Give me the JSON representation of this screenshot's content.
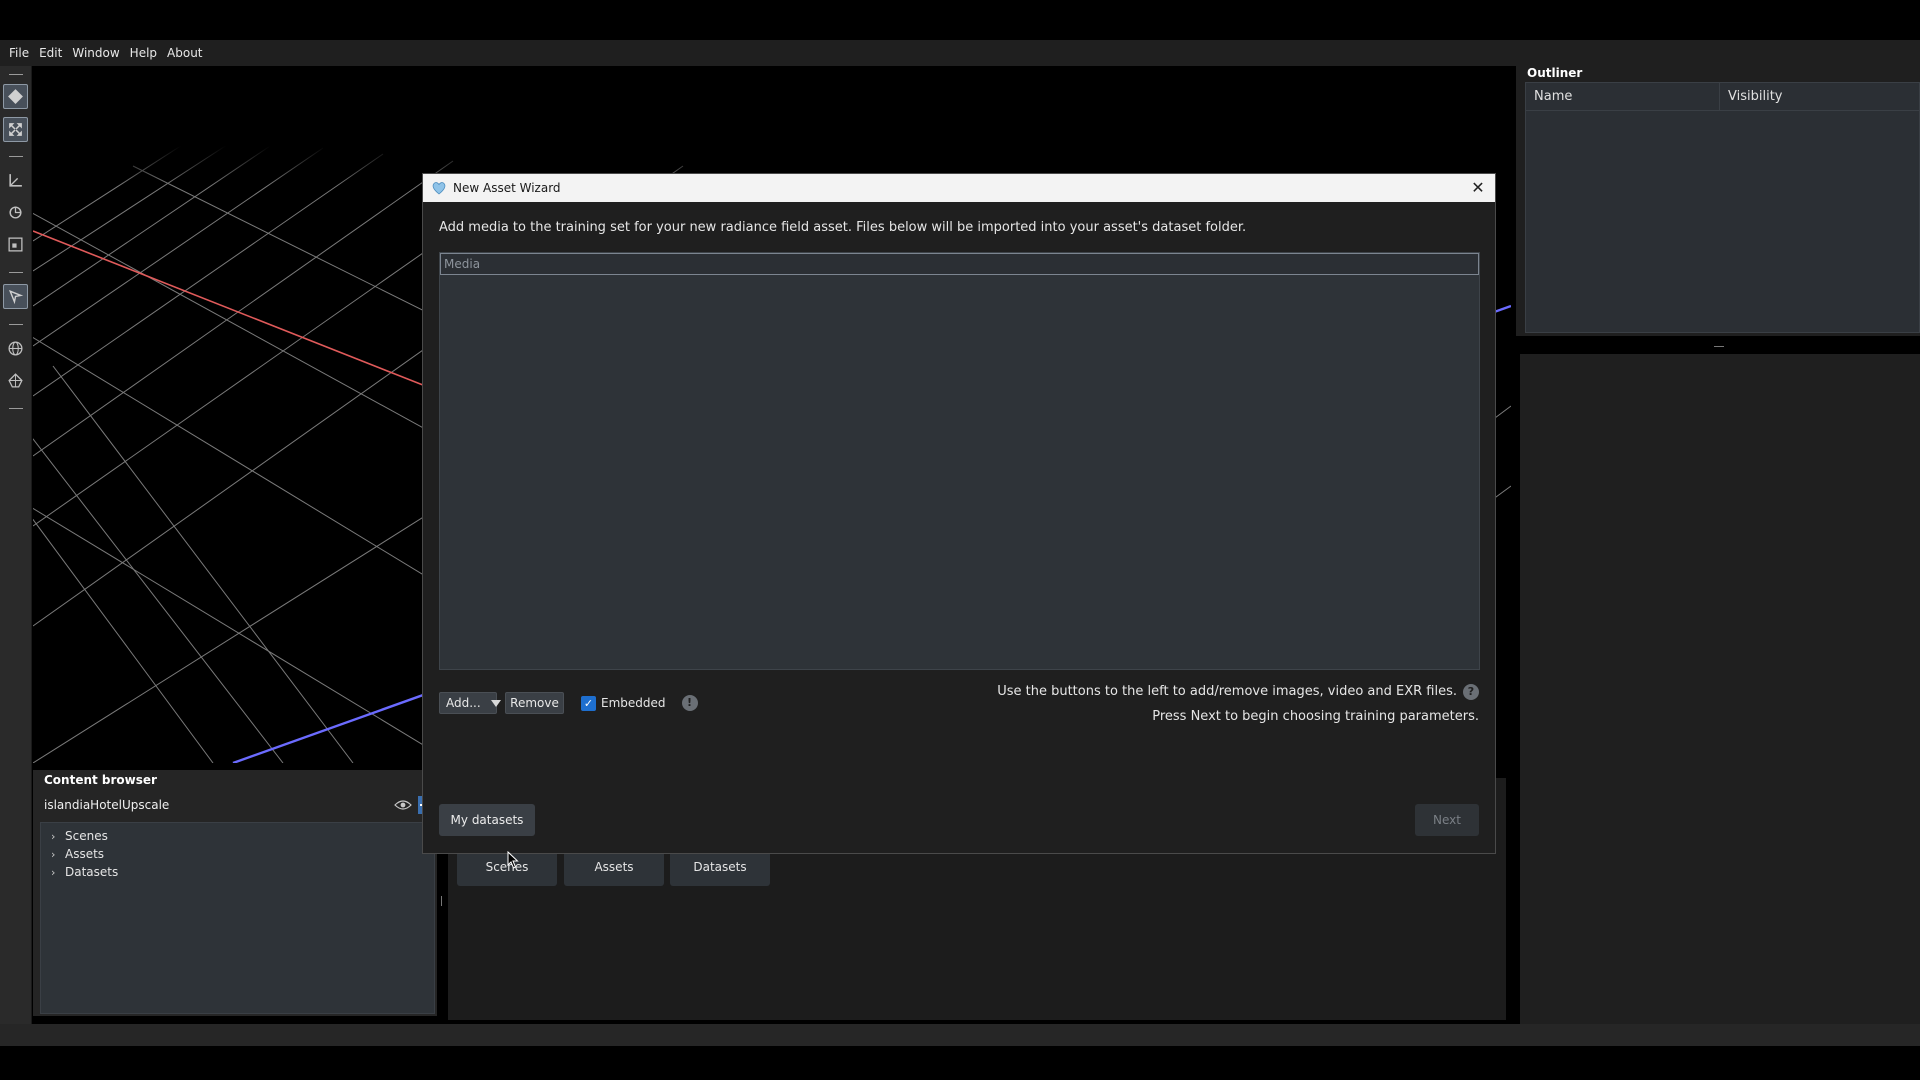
{
  "menu": [
    "File",
    "Edit",
    "Window",
    "Help",
    "About"
  ],
  "outliner": {
    "title": "Outliner",
    "columns": [
      "Name",
      "Visibility"
    ]
  },
  "content_browser": {
    "title": "Content browser",
    "project": "islandiaHotelUpscale",
    "tree": [
      "Scenes",
      "Assets",
      "Datasets"
    ]
  },
  "content_tabs": [
    "Scenes",
    "Assets",
    "Datasets"
  ],
  "dialog": {
    "title": "New Asset Wizard",
    "description": "Add media to the training set for your new radiance field asset. Files below will be imported into your asset's dataset folder.",
    "media_header": "Media",
    "add_label": "Add...",
    "remove_label": "Remove",
    "embedded_label": "Embedded",
    "embedded_checked": true,
    "hint_line1": "Use the buttons to the left to add/remove images, video and EXR files.",
    "hint_line2": "Press Next to begin choosing training parameters.",
    "my_datasets_label": "My datasets",
    "next_label": "Next",
    "next_enabled": false
  },
  "icons": {
    "info": "!",
    "help": "?",
    "close": "✕",
    "check": "✓",
    "chevron": "›"
  },
  "colors": {
    "accent_checkbox": "#1e6fcf",
    "grid_red_axis": "#e05a5a",
    "grid_blue_axis": "#6b6bff"
  }
}
